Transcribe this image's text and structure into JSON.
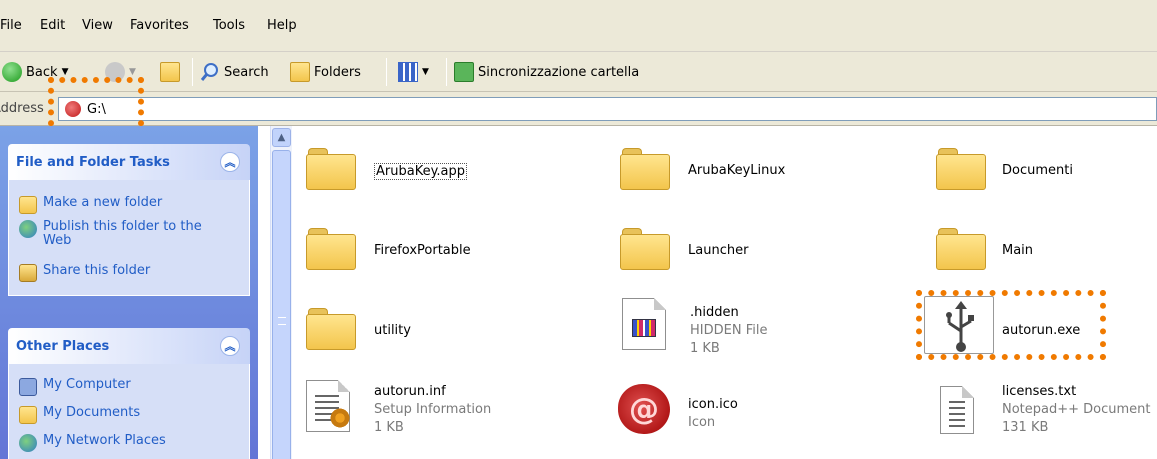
{
  "menu": [
    "File",
    "Edit",
    "View",
    "Favorites",
    "Tools",
    "Help"
  ],
  "toolbar": {
    "back": "Back",
    "search": "Search",
    "folders": "Folders",
    "sync": "Sincronizzazione cartella"
  },
  "address": {
    "label": "Address",
    "value": "G:\\"
  },
  "taskpane": {
    "file_tasks": {
      "title": "File and Folder Tasks",
      "items": [
        "Make a new folder",
        "Publish this folder to the Web",
        "Share this folder"
      ]
    },
    "other_places": {
      "title": "Other Places",
      "items": [
        "My Computer",
        "My Documents",
        "My Network Places"
      ]
    }
  },
  "files": [
    {
      "name": "ArubaKey.app",
      "type": "folder"
    },
    {
      "name": "ArubaKeyLinux",
      "type": "folder"
    },
    {
      "name": "Documenti",
      "type": "folder"
    },
    {
      "name": "FirefoxPortable",
      "type": "folder"
    },
    {
      "name": "Launcher",
      "type": "folder"
    },
    {
      "name": "Main",
      "type": "folder"
    },
    {
      "name": "utility",
      "type": "folder"
    },
    {
      "name": ".hidden",
      "type": "file",
      "kind": "HIDDEN File",
      "size": "1 KB"
    },
    {
      "name": "autorun.exe",
      "type": "exe"
    },
    {
      "name": "autorun.inf",
      "type": "file",
      "kind": "Setup Information",
      "size": "1 KB"
    },
    {
      "name": "icon.ico",
      "type": "file",
      "kind": "Icon"
    },
    {
      "name": "licenses.txt",
      "type": "file",
      "kind": "Notepad++ Document",
      "size": "131 KB"
    }
  ],
  "colors": {
    "highlight": "#f07a00",
    "link": "#215dc6"
  }
}
